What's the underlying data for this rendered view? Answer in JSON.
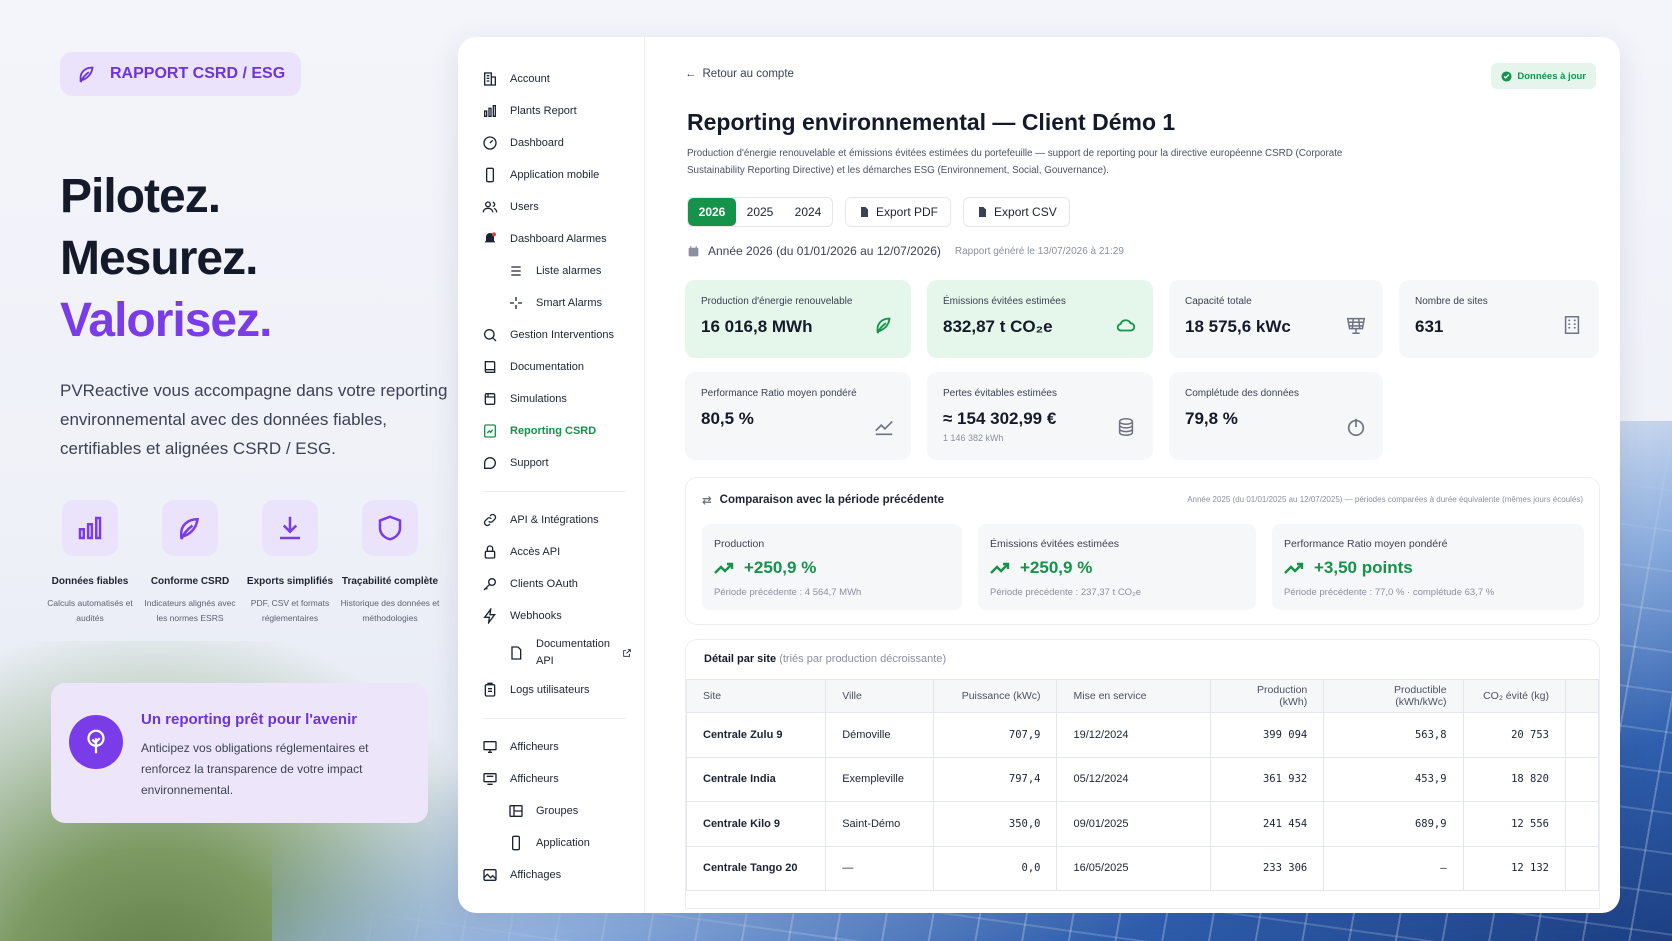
{
  "hero": {
    "badge": "RAPPORT CSRD / ESG",
    "line1": "Pilotez.",
    "line2": "Mesurez.",
    "line3": "Valorisez.",
    "lead": "PVReactive vous accompagne dans votre reporting environnemental avec des données fiables, certifiables et alignées CSRD / ESG.",
    "features": [
      {
        "title": "Données fiables",
        "desc": "Calculs automatisés et audités",
        "icon": "bar-chart-icon"
      },
      {
        "title": "Conforme CSRD",
        "desc": "Indicateurs alignés avec les normes ESRS",
        "icon": "leaf-icon"
      },
      {
        "title": "Exports simplifiés",
        "desc": "PDF, CSV et formats réglementaires",
        "icon": "download-icon"
      },
      {
        "title": "Traçabilité complète",
        "desc": "Historique des données et méthodologies",
        "icon": "shield-icon"
      }
    ],
    "future": {
      "title": "Un reporting prêt pour l'avenir",
      "desc": "Anticipez vos obligations réglementaires et renforcez la transparence de votre impact environnemental."
    }
  },
  "sidebar": {
    "items": [
      {
        "label": "Account"
      },
      {
        "label": "Plants Report"
      },
      {
        "label": "Dashboard"
      },
      {
        "label": "Application mobile"
      },
      {
        "label": "Users"
      },
      {
        "label": "Dashboard Alarmes"
      },
      {
        "label": "Liste alarmes"
      },
      {
        "label": "Smart Alarms"
      },
      {
        "label": "Gestion Interventions"
      },
      {
        "label": "Documentation"
      },
      {
        "label": "Simulations"
      },
      {
        "label": "Reporting CSRD"
      },
      {
        "label": "Support"
      },
      {
        "label": "API & Intégrations"
      },
      {
        "label": "Accès API"
      },
      {
        "label": "Clients OAuth"
      },
      {
        "label": "Webhooks"
      },
      {
        "label": "Documentation API"
      },
      {
        "label": "Logs utilisateurs"
      },
      {
        "label": "Afficheurs"
      },
      {
        "label": "Afficheurs"
      },
      {
        "label": "Groupes"
      },
      {
        "label": "Application"
      },
      {
        "label": "Affichages"
      }
    ]
  },
  "main": {
    "back": "Retour au compte",
    "status": "Données à jour",
    "title": "Reporting environnemental — Client Démo 1",
    "desc": "Production d'énergie renouvelable et émissions évitées estimées du portefeuille — support de reporting pour la directive européenne CSRD (Corporate Sustainability Reporting Directive) et les démarches ESG (Environnement, Social, Gouvernance).",
    "years": [
      "2026",
      "2025",
      "2024"
    ],
    "export_pdf": "Export PDF",
    "export_csv": "Export CSV",
    "period": "Année 2026 (du 01/01/2026 au 12/07/2026)",
    "generated": "Rapport généré le 13/07/2026 à 21:29",
    "kpis": [
      {
        "label": "Production d'énergie renouvelable",
        "value": "16 016,8 MWh",
        "icon": "leaf-icon"
      },
      {
        "label": "Émissions évitées estimées",
        "value": "832,87 t CO₂e",
        "icon": "cloud-icon"
      },
      {
        "label": "Capacité totale",
        "value": "18 575,6 kWc",
        "icon": "solar-panel-icon"
      },
      {
        "label": "Nombre de sites",
        "value": "631",
        "icon": "building-icon"
      },
      {
        "label": "Performance Ratio moyen pondéré",
        "value": "80,5 %",
        "icon": "trend-icon"
      },
      {
        "label": "Pertes évitables estimées",
        "value": "≈ 154 302,99 €",
        "sub": "1 146 382 kWh",
        "icon": "coins-icon"
      },
      {
        "label": "Complétude des données",
        "value": "79,8 %",
        "icon": "power-icon"
      }
    ],
    "comparison": {
      "title": "Comparaison avec la période précédente",
      "note": "Année 2025 (du 01/01/2025 au 12/07/2025) — périodes comparées à durée équivalente (mêmes jours écoulés)",
      "items": [
        {
          "label": "Production",
          "value": "+250,9 %",
          "prev": "Période précédente : 4 564,7 MWh"
        },
        {
          "label": "Émissions évitées estimées",
          "value": "+250,9 %",
          "prev": "Période précédente : 237,37 t CO₂e"
        },
        {
          "label": "Performance Ratio moyen pondéré",
          "value": "+3,50 points",
          "prev": "Période précédente : 77,0 % · complétude 63,7 %"
        }
      ]
    },
    "detail": {
      "title": "Détail par site",
      "subtitle": "(triés par production décroissante)",
      "columns": [
        "Site",
        "Ville",
        "Puissance (kWc)",
        "Mise en service",
        "Production (kWh)",
        "Productible (kWh/kWc)",
        "CO₂ évité (kg)"
      ],
      "rows": [
        [
          "Centrale Zulu 9",
          "Démoville",
          "707,9",
          "19/12/2024",
          "399 094",
          "563,8",
          "20 753"
        ],
        [
          "Centrale India",
          "Exempleville",
          "797,4",
          "05/12/2024",
          "361 932",
          "453,9",
          "18 820"
        ],
        [
          "Centrale Kilo 9",
          "Saint-Démo",
          "350,0",
          "09/01/2025",
          "241 454",
          "689,9",
          "12 556"
        ],
        [
          "Centrale Tango 20",
          "—",
          "0,0",
          "16/05/2025",
          "233 306",
          "—",
          "12 132"
        ]
      ]
    }
  },
  "colors": {
    "accent": "#7a3ce8",
    "green": "#15934a"
  }
}
